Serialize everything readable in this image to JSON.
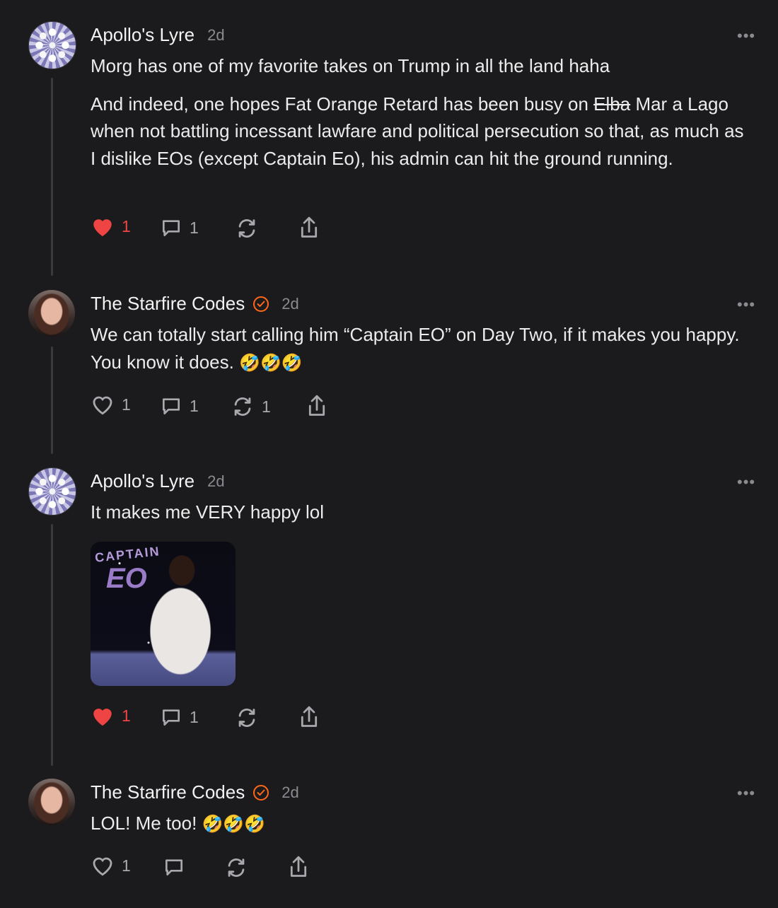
{
  "posts": [
    {
      "author": "Apollo's Lyre",
      "time": "2d",
      "more": "•••",
      "paragraphs": [
        "Morg has one of my favorite takes on Trump in all the land haha"
      ],
      "para2_before": "And indeed, one hopes Fat Orange Retard has been busy on ",
      "para2_strike": "Elba",
      "para2_after": " Mar a Lago when not battling incessant lawfare and political persecution so that, as much as I dislike EOs (except Captain Eo), his admin can hit the ground running.",
      "like_count": "1",
      "comment_count": "1",
      "liked": true
    },
    {
      "author": "The Starfire Codes",
      "time": "2d",
      "more": "•••",
      "text": "We can totally start calling him “Captain EO” on Day Two, if it makes you happy. You know it does. ",
      "emoji": "🤣🤣🤣",
      "like_count": "1",
      "comment_count": "1",
      "restack_count": "1",
      "liked": false
    },
    {
      "author": "Apollo's Lyre",
      "time": "2d",
      "more": "•••",
      "text": "It makes me VERY happy lol",
      "image_caption_top": "CAPTAIN",
      "image_caption_logo": "EO",
      "like_count": "1",
      "comment_count": "1",
      "liked": true
    },
    {
      "author": "The Starfire Codes",
      "time": "2d",
      "more": "•••",
      "text": "LOL! Me too! ",
      "emoji": "🤣🤣🤣",
      "like_count": "1",
      "liked": false
    }
  ],
  "colors": {
    "background": "#1b1b1d",
    "like_active": "#ef4444",
    "verified_badge": "#ff6719",
    "muted": "#8a8a8f"
  },
  "icons": [
    "heart-icon",
    "comment-icon",
    "restack-icon",
    "share-icon",
    "more-icon",
    "verified-badge-icon"
  ]
}
